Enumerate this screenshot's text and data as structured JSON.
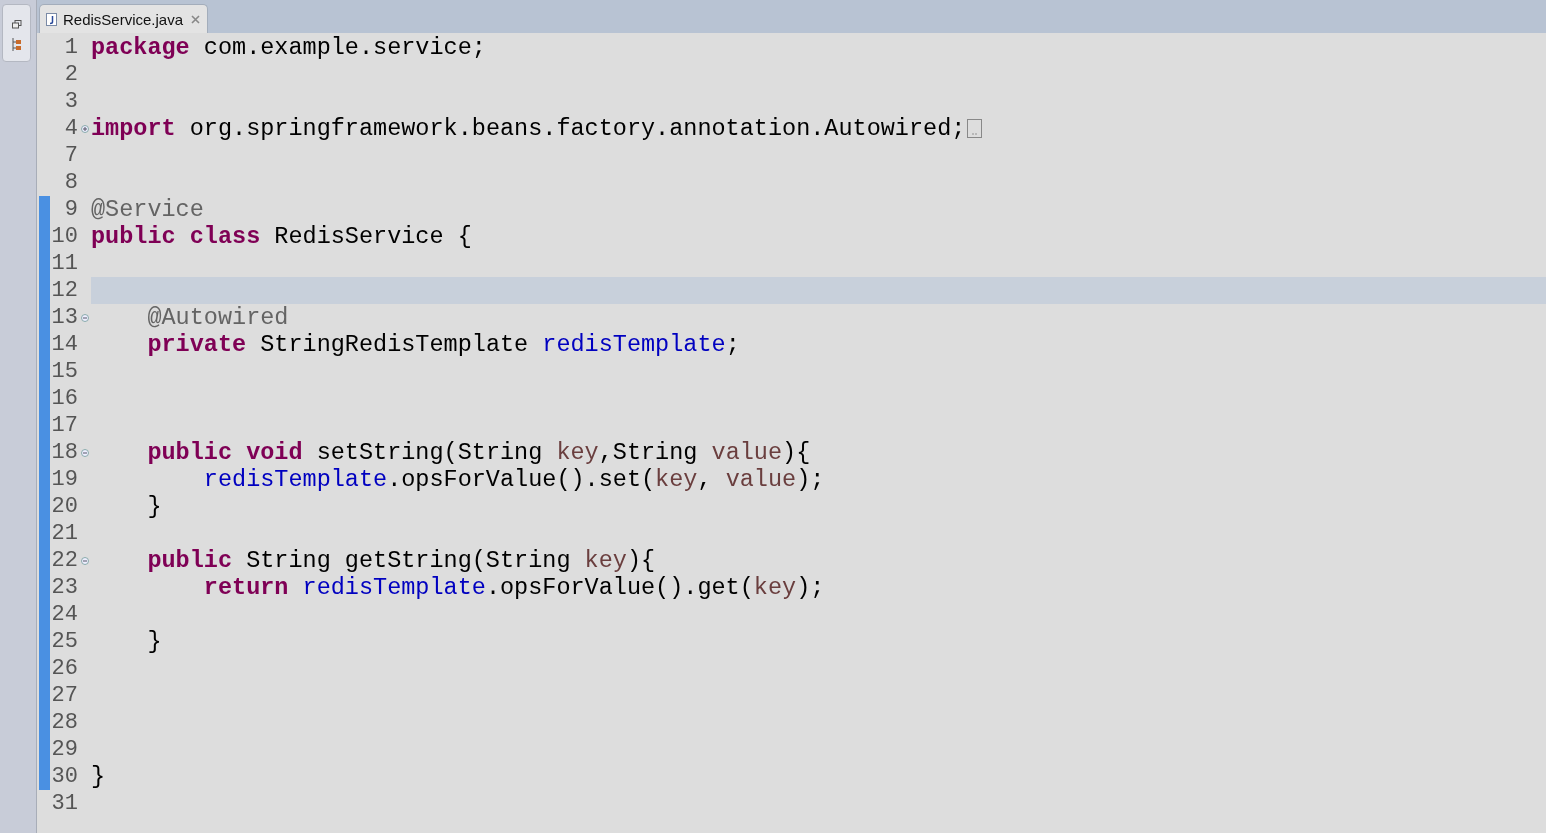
{
  "tab": {
    "title": "RedisService.java",
    "selected": true
  },
  "lines": [
    {
      "number": "1",
      "changed": false,
      "current": false,
      "tokens": [
        {
          "kind": "keyword",
          "text": "package"
        },
        {
          "kind": "plain",
          "text": " com.example.service;"
        }
      ]
    },
    {
      "number": "2",
      "changed": false,
      "current": false
    },
    {
      "number": "3",
      "changed": false,
      "current": false
    },
    {
      "number": "4",
      "expanded": false,
      "changed": false,
      "current": false,
      "tokens": [
        {
          "kind": "keyword",
          "text": "import"
        },
        {
          "kind": "plain",
          "text": " org.springframework.beans.factory.annotation.Autowired;"
        }
      ]
    },
    {
      "number": "7",
      "changed": false,
      "current": false
    },
    {
      "number": "8",
      "changed": false,
      "current": false
    },
    {
      "number": "9",
      "changed": true,
      "current": false,
      "tokens": [
        {
          "kind": "annotation",
          "text": "@Service"
        }
      ]
    },
    {
      "number": "10",
      "changed": true,
      "current": false,
      "tokens": [
        {
          "kind": "keyword",
          "text": "public class"
        },
        {
          "kind": "plain",
          "text": " RedisService {"
        }
      ]
    },
    {
      "number": "11",
      "changed": true,
      "current": false
    },
    {
      "number": "12",
      "changed": true,
      "current": true
    },
    {
      "number": "13",
      "expanded": true,
      "changed": true,
      "current": false,
      "tokens": [
        {
          "kind": "annotation",
          "text": "    @Autowired"
        }
      ]
    },
    {
      "number": "14",
      "changed": true,
      "current": false,
      "tokens": [
        {
          "kind": "keyword",
          "text": "    private"
        },
        {
          "kind": "plain",
          "text": " StringRedisTemplate "
        },
        {
          "kind": "field",
          "text": "redisTemplate"
        },
        {
          "kind": "plain",
          "text": ";"
        }
      ]
    },
    {
      "number": "15",
      "changed": true,
      "current": false
    },
    {
      "number": "16",
      "changed": true,
      "current": false
    },
    {
      "number": "17",
      "changed": true,
      "current": false
    },
    {
      "number": "18",
      "expanded": true,
      "changed": true,
      "current": false,
      "tokens": [
        {
          "kind": "keyword",
          "text": "    public void"
        },
        {
          "kind": "plain",
          "text": " setString(String "
        },
        {
          "kind": "param",
          "text": "key"
        },
        {
          "kind": "plain",
          "text": ",String "
        },
        {
          "kind": "param",
          "text": "value"
        },
        {
          "kind": "plain",
          "text": "){"
        }
      ]
    },
    {
      "number": "19",
      "changed": true,
      "current": false,
      "tokens": [
        {
          "kind": "field",
          "text": "        redisTemplate"
        },
        {
          "kind": "plain",
          "text": ".opsForValue().set("
        },
        {
          "kind": "param",
          "text": "key"
        },
        {
          "kind": "plain",
          "text": ", "
        },
        {
          "kind": "param",
          "text": "value"
        },
        {
          "kind": "plain",
          "text": ");"
        }
      ]
    },
    {
      "number": "20",
      "changed": true,
      "current": false,
      "tokens": [
        {
          "kind": "plain",
          "text": "    }"
        }
      ]
    },
    {
      "number": "21",
      "changed": true,
      "current": false
    },
    {
      "number": "22",
      "expanded": true,
      "changed": true,
      "current": false,
      "tokens": [
        {
          "kind": "keyword",
          "text": "    public"
        },
        {
          "kind": "plain",
          "text": " String getString(String "
        },
        {
          "kind": "param",
          "text": "key"
        },
        {
          "kind": "plain",
          "text": "){"
        }
      ]
    },
    {
      "number": "23",
      "changed": true,
      "current": false,
      "tokens": [
        {
          "kind": "keyword",
          "text": "        return"
        },
        {
          "kind": "field",
          "text": " redisTemplate"
        },
        {
          "kind": "plain",
          "text": ".opsForValue().get("
        },
        {
          "kind": "param",
          "text": "key"
        },
        {
          "kind": "plain",
          "text": ");"
        }
      ]
    },
    {
      "number": "24",
      "changed": true,
      "current": false
    },
    {
      "number": "25",
      "changed": true,
      "current": false,
      "tokens": [
        {
          "kind": "plain",
          "text": "    }"
        }
      ]
    },
    {
      "number": "26",
      "changed": true,
      "current": false
    },
    {
      "number": "27",
      "changed": true,
      "current": false
    },
    {
      "number": "28",
      "changed": true,
      "current": false
    },
    {
      "number": "29",
      "changed": true,
      "current": false
    },
    {
      "number": "30",
      "changed": true,
      "current": false,
      "tokens": [
        {
          "kind": "plain",
          "text": "}"
        }
      ]
    },
    {
      "number": "31",
      "changed": false,
      "current": false
    }
  ]
}
